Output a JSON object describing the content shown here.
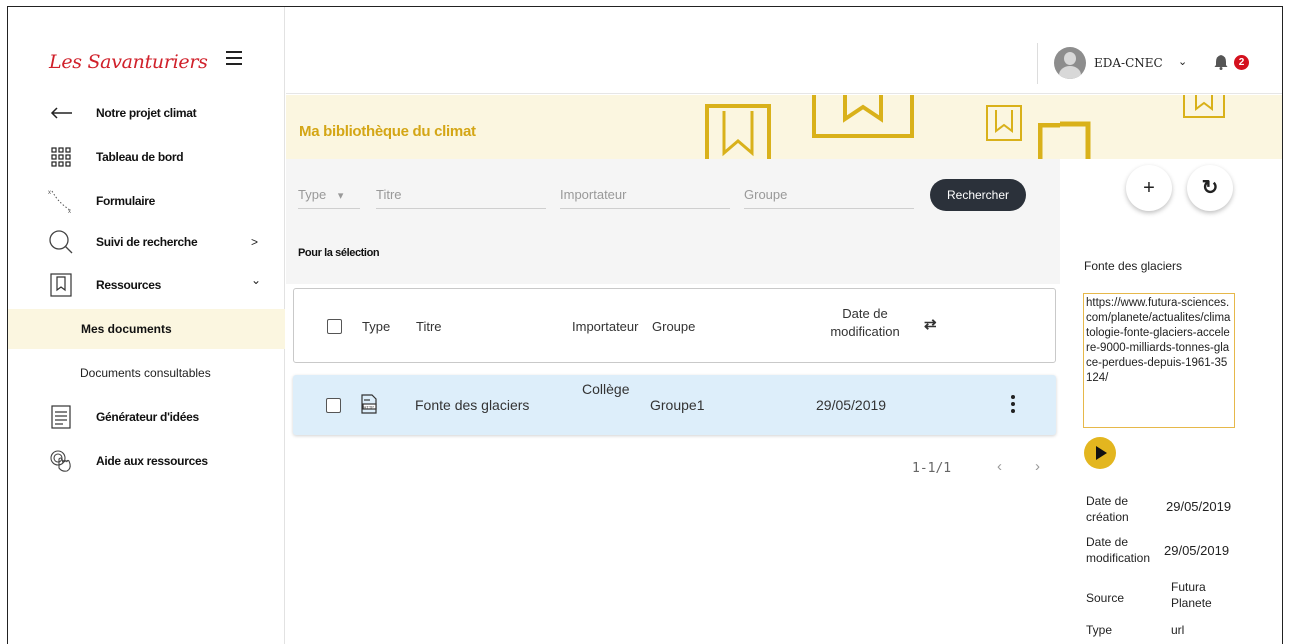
{
  "app": {
    "logo_text": "Les Savanturiers"
  },
  "sidebar": {
    "items": [
      {
        "label": "Notre projet climat",
        "icon": "arrow-left-icon"
      },
      {
        "label": "Tableau de bord",
        "icon": "grid-icon"
      },
      {
        "label": "Formulaire",
        "icon": "path-icon"
      },
      {
        "label": "Suivi de recherche",
        "icon": "search-icon",
        "chevron": ">"
      },
      {
        "label": "Ressources",
        "icon": "bookmark-icon",
        "chevron": "⌄"
      },
      {
        "label": "Générateur d'idées",
        "icon": "document-icon"
      },
      {
        "label": "Aide aux ressources",
        "icon": "hand-icon"
      }
    ],
    "subitems": [
      {
        "label": "Mes documents",
        "active": true
      },
      {
        "label": "Documents consultables",
        "active": false
      }
    ]
  },
  "header": {
    "username": "EDA-CNEC",
    "user_chevron": "⌄",
    "notification_count": "2"
  },
  "banner": {
    "title": "Ma bibliothèque du climat"
  },
  "filters": {
    "type_placeholder": "Type",
    "type_arrow": "▾",
    "titre_placeholder": "Titre",
    "importateur_placeholder": "Importateur",
    "groupe_placeholder": "Groupe",
    "search_label": "Rechercher",
    "selection_label": "Pour la sélection"
  },
  "table": {
    "headers": {
      "type": "Type",
      "titre": "Titre",
      "importateur": "Importateur",
      "groupe": "Groupe",
      "date_line1": "Date de",
      "date_line2": "modification",
      "sort_icon": "⇄"
    },
    "rows": [
      {
        "type_icon": "http-file-icon",
        "titre": "Fonte des glaciers",
        "importateur": "Collège",
        "groupe": "Groupe1",
        "date": "29/05/2019"
      }
    ],
    "pagination": {
      "range": "1-1/1",
      "prev": "‹",
      "next": "›"
    }
  },
  "detail": {
    "add_label": "+",
    "refresh_label": "↻",
    "title": "Fonte des glaciers",
    "url": "https://www.futura-sciences.com/planete/actualites/climatologie-fonte-glaciers-accelere-9000-milliards-tonnes-glace-perdues-depuis-1961-35124/",
    "fields": [
      {
        "label": "Date de création",
        "value": "29/05/2019"
      },
      {
        "label": "Date de modification",
        "value": "29/05/2019"
      },
      {
        "label": "Source",
        "value": "Futura Planete"
      },
      {
        "label": "Type",
        "value": "url"
      }
    ]
  },
  "colors": {
    "accent": "#d4a616",
    "brand": "#d0202a",
    "row_highlight": "#ddeefa",
    "button_dark": "#2b313a"
  }
}
